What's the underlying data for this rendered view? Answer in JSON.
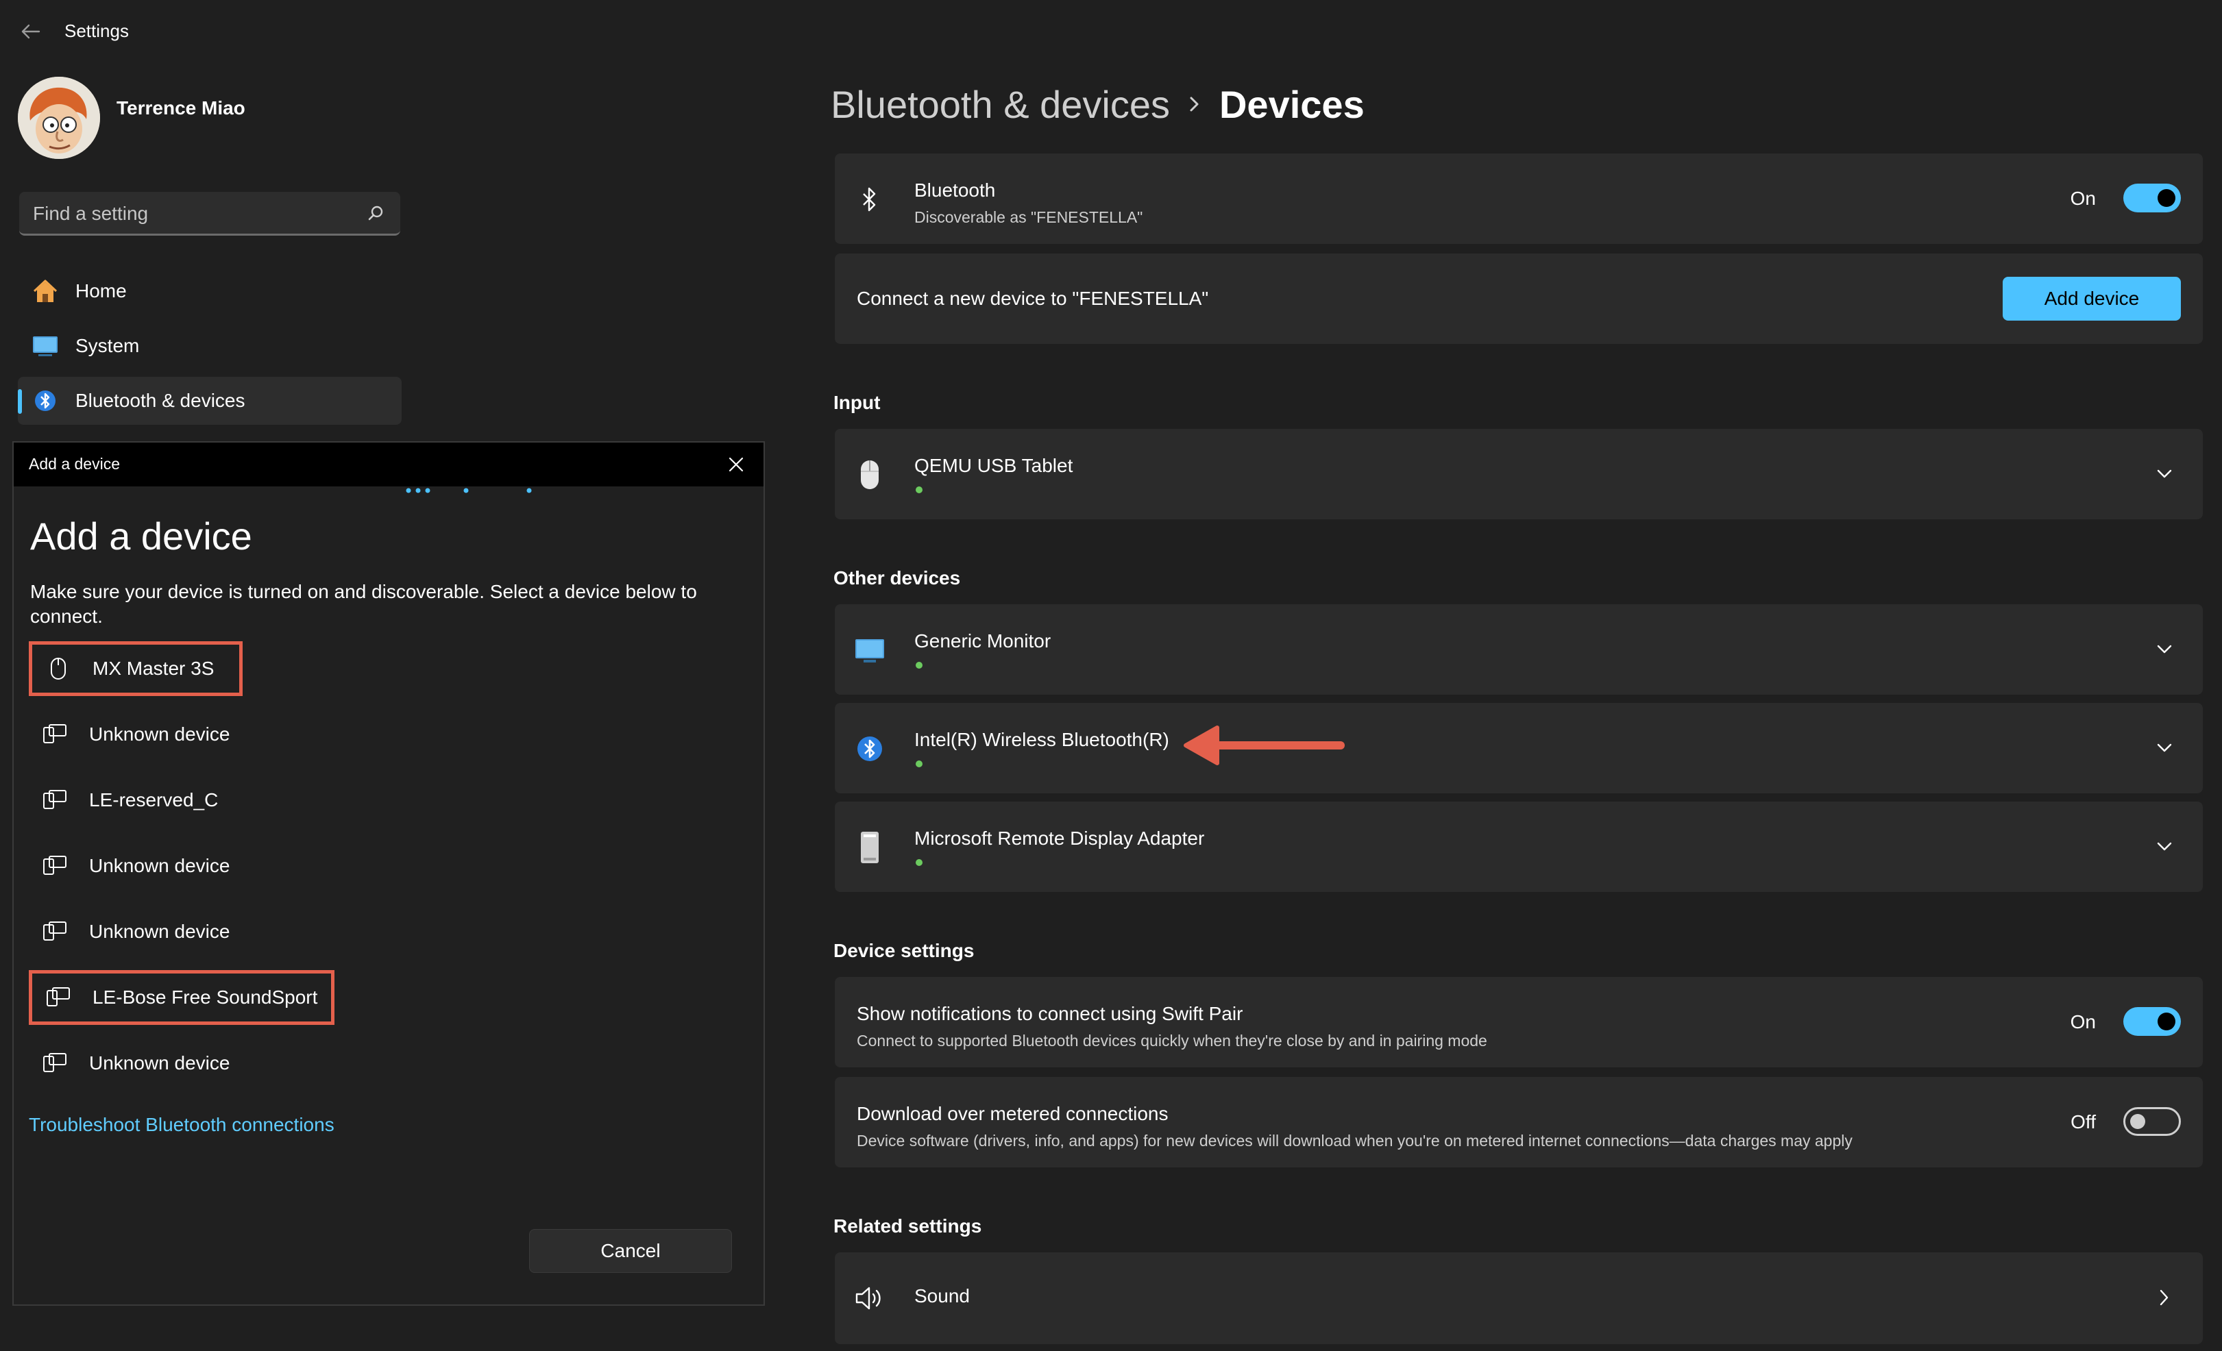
{
  "app": {
    "title": "Settings"
  },
  "user": {
    "name": "Terrence Miao"
  },
  "search": {
    "placeholder": "Find a setting"
  },
  "sidebar": {
    "items": [
      {
        "label": "Home",
        "icon": "home-icon"
      },
      {
        "label": "System",
        "icon": "monitor-icon"
      },
      {
        "label": "Bluetooth & devices",
        "icon": "bluetooth-icon",
        "selected": true
      }
    ]
  },
  "dialog": {
    "titlebar": "Add a device",
    "heading": "Add a device",
    "description": "Make sure your device is turned on and discoverable. Select a device below to connect.",
    "devices": [
      {
        "label": "MX Master 3S",
        "icon": "mouse-icon",
        "highlighted": true
      },
      {
        "label": "Unknown device",
        "icon": "device-generic-icon"
      },
      {
        "label": "LE-reserved_C",
        "icon": "device-generic-icon"
      },
      {
        "label": "Unknown device",
        "icon": "device-generic-icon"
      },
      {
        "label": "Unknown device",
        "icon": "device-generic-icon"
      },
      {
        "label": "LE-Bose Free SoundSport",
        "icon": "device-generic-icon",
        "highlighted": true
      },
      {
        "label": "Unknown device",
        "icon": "device-generic-icon"
      }
    ],
    "troubleshoot_link": "Troubleshoot Bluetooth connections",
    "cancel_label": "Cancel"
  },
  "breadcrumb": {
    "parent": "Bluetooth & devices",
    "current": "Devices"
  },
  "bluetooth_card": {
    "title": "Bluetooth",
    "subtitle": "Discoverable as \"FENESTELLA\"",
    "toggle_label": "On",
    "toggle_on": true
  },
  "connect_card": {
    "text": "Connect a new device to \"FENESTELLA\"",
    "button_label": "Add device"
  },
  "sections": {
    "input": "Input",
    "other_devices": "Other devices",
    "device_settings": "Device settings",
    "related_settings": "Related settings"
  },
  "input_devices": [
    {
      "name": "QEMU USB Tablet",
      "icon": "mouse-icon"
    }
  ],
  "other_devices": [
    {
      "name": "Generic Monitor",
      "icon": "monitor-icon"
    },
    {
      "name": "Intel(R) Wireless Bluetooth(R)",
      "icon": "bluetooth-icon"
    },
    {
      "name": "Microsoft Remote Display Adapter",
      "icon": "display-adapter-icon"
    }
  ],
  "device_settings": {
    "swift_pair": {
      "title": "Show notifications to connect using Swift Pair",
      "subtitle": "Connect to supported Bluetooth devices quickly when they're close by and in pairing mode",
      "toggle_label": "On",
      "toggle_on": true
    },
    "metered": {
      "title": "Download over metered connections",
      "subtitle": "Device software (drivers, info, and apps) for new devices will download when you're on metered internet connections—data charges may apply",
      "toggle_label": "Off",
      "toggle_on": false
    }
  },
  "related_settings": [
    {
      "label": "Sound",
      "icon": "speaker-icon"
    }
  ],
  "colors": {
    "accent": "#4cc2ff",
    "annotation": "#e4604c",
    "status_connected": "#6ccb5f",
    "link": "#60cdff"
  }
}
